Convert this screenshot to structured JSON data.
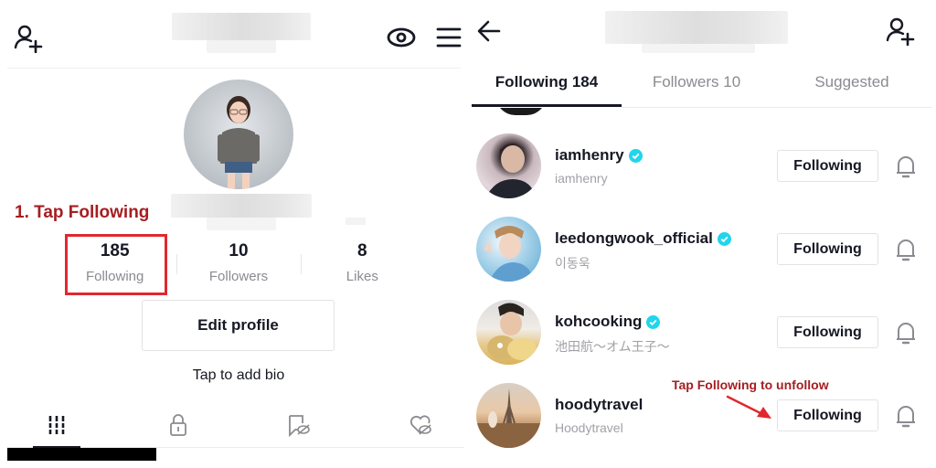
{
  "colors": {
    "annotation_red": "#a51e22",
    "highlight_red": "#e0282e",
    "text_primary": "#161823",
    "text_secondary": "#8a8b91",
    "verified_blue": "#20d5ec"
  },
  "left_panel": {
    "header": {
      "add_user_icon": "person-plus-icon",
      "title_redacted": true,
      "eye_icon": "eye-icon",
      "menu_icon": "hamburger-menu-icon"
    },
    "annotation": "1. Tap Following",
    "stats": [
      {
        "value": "185",
        "label": "Following"
      },
      {
        "value": "10",
        "label": "Followers"
      },
      {
        "value": "8",
        "label": "Likes"
      }
    ],
    "edit_profile_label": "Edit profile",
    "bio_placeholder": "Tap to add bio",
    "content_tabs": [
      {
        "icon": "grid-videos-icon",
        "active": true
      },
      {
        "icon": "lock-icon",
        "active": false
      },
      {
        "icon": "saved-hidden-icon",
        "active": false
      },
      {
        "icon": "liked-hidden-icon",
        "active": false
      }
    ]
  },
  "right_panel": {
    "header": {
      "back_icon": "arrow-left-icon",
      "title_redacted": true,
      "add_user_icon": "person-plus-icon"
    },
    "tabs": [
      {
        "label": "Following 184",
        "active": true
      },
      {
        "label": "Followers 10",
        "active": false
      },
      {
        "label": "Suggested",
        "active": false
      }
    ],
    "annotation": "Tap Following to unfollow",
    "users": [
      {
        "username": "iamhenry",
        "display_name": "iamhenry",
        "verified": true,
        "button": "Following"
      },
      {
        "username": "leedongwook_official",
        "display_name": "이동욱",
        "verified": true,
        "button": "Following"
      },
      {
        "username": "kohcooking",
        "display_name": "池田航〜オム王子〜",
        "verified": true,
        "button": "Following"
      },
      {
        "username": "hoodytravel",
        "display_name": "Hoodytravel",
        "verified": false,
        "button": "Following"
      }
    ]
  }
}
